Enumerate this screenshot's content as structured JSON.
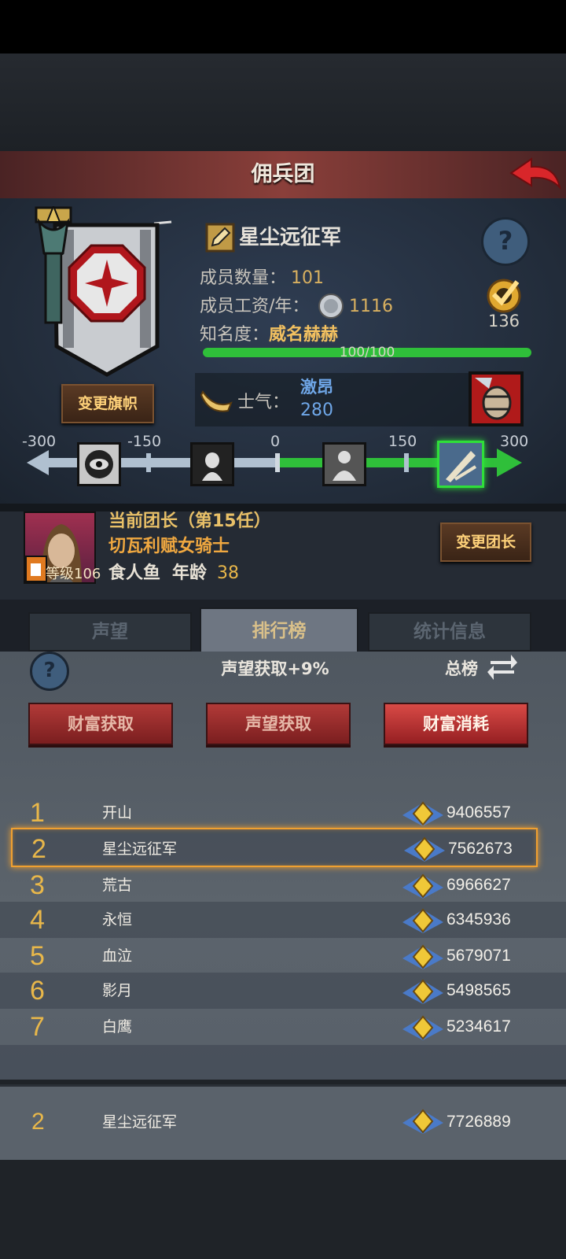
{
  "header": {
    "title": "佣兵团"
  },
  "guild": {
    "name": "星尘远征军",
    "members_label": "成员数量：",
    "members_value": "101",
    "salary_label": "成员工资/年：",
    "salary_value": "1116",
    "fame_label": "知名度：",
    "fame_value": "威名赫赫",
    "fame_progress_text": "100/100",
    "fame_progress": 1.0,
    "badge_count": "136",
    "change_flag_label": "变更旗帜",
    "morale_label": "士气：",
    "morale_state": "激昂",
    "morale_value": "280"
  },
  "morale_scale": {
    "ticks": [
      "-300",
      "-150",
      "0",
      "150",
      "300"
    ],
    "current": 280,
    "min": -300,
    "max": 300
  },
  "leader": {
    "title": "当前团长（第15任）",
    "name": "切瓦利赋女骑士",
    "level_label": "等级106",
    "race": "食人鱼",
    "age_label": "年龄",
    "age_value": "38",
    "change_leader_label": "变更团长"
  },
  "tabs": [
    {
      "label": "声望",
      "active": false
    },
    {
      "label": "排行榜",
      "active": true
    },
    {
      "label": "统计信息",
      "active": false
    }
  ],
  "ranking": {
    "bonus_text": "声望获取+9%",
    "scope_label": "总榜",
    "filters": [
      {
        "label": "财富获取",
        "active": false
      },
      {
        "label": "声望获取",
        "active": false
      },
      {
        "label": "财富消耗",
        "active": true
      }
    ],
    "rows": [
      {
        "rank": "1",
        "name": "开山",
        "value": "9406557"
      },
      {
        "rank": "2",
        "name": "星尘远征军",
        "value": "7562673"
      },
      {
        "rank": "3",
        "name": "荒古",
        "value": "6966627"
      },
      {
        "rank": "4",
        "name": "永恒",
        "value": "6345936"
      },
      {
        "rank": "5",
        "name": "血泣",
        "value": "5679071"
      },
      {
        "rank": "6",
        "name": "影月",
        "value": "5498565"
      },
      {
        "rank": "7",
        "name": "白鹰",
        "value": "5234617"
      }
    ],
    "my_row": {
      "rank": "2",
      "name": "星尘远征军",
      "value": "7726889"
    }
  },
  "colors": {
    "accent_gold": "#e8b74a",
    "header_red": "#8a3f3a",
    "button_red": "#b23a38",
    "progress_green": "#2fbf3a"
  }
}
